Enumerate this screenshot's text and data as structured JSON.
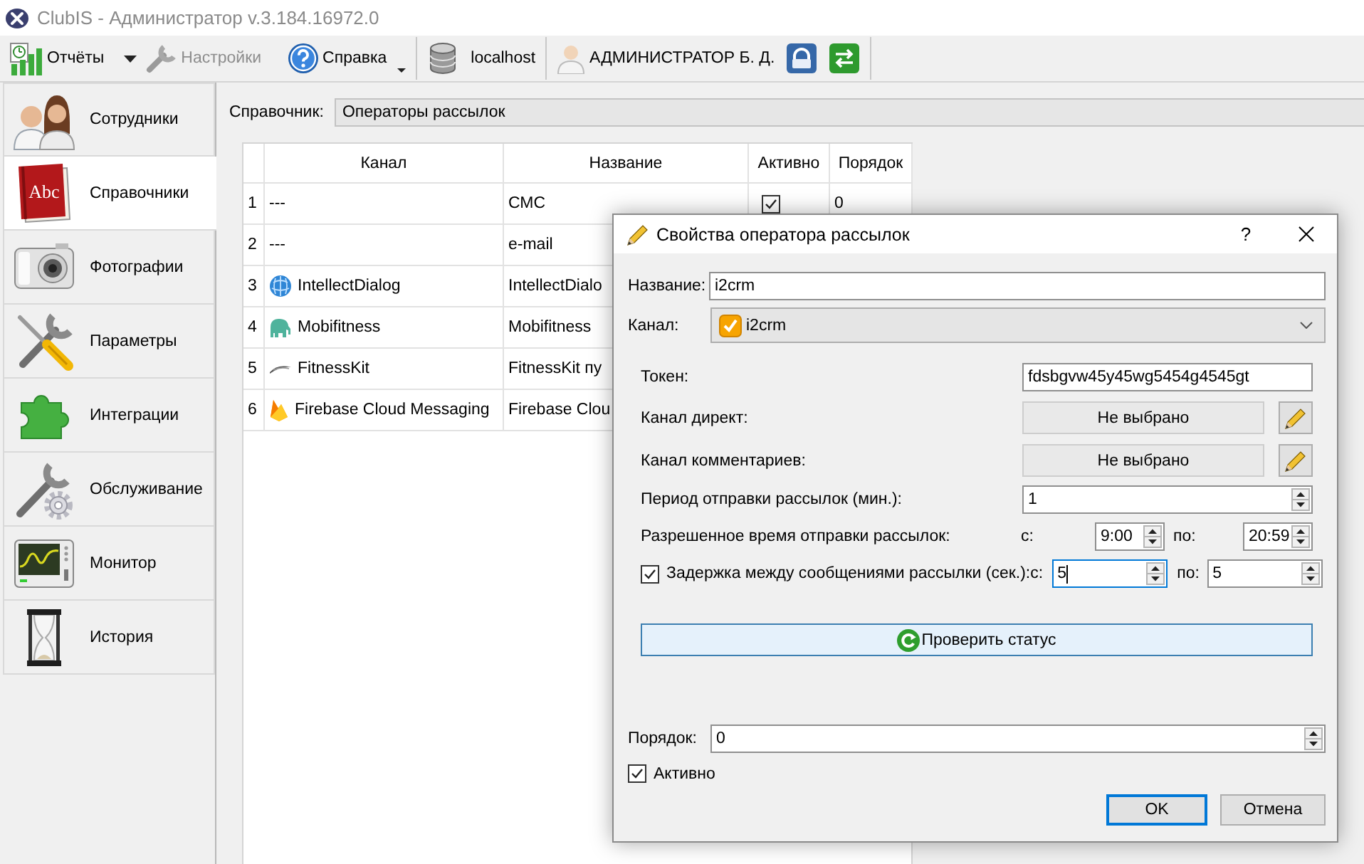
{
  "window": {
    "title": "ClubIS - Администратор v.3.184.16972.0"
  },
  "toolbar": {
    "menus": [
      {
        "label": "Отчёты",
        "disabled": false
      },
      {
        "label": "Настройки",
        "disabled": true
      },
      {
        "label": "Справка",
        "disabled": false
      }
    ],
    "server": "localhost",
    "user": "АДМИНИСТРАТОР Б. Д."
  },
  "sidebar": {
    "items": [
      {
        "label": "Сотрудники",
        "selected": false
      },
      {
        "label": "Справочники",
        "selected": true,
        "icon_text": "Abc"
      },
      {
        "label": "Фотографии",
        "selected": false
      },
      {
        "label": "Параметры",
        "selected": false
      },
      {
        "label": "Интеграции",
        "selected": false
      },
      {
        "label": "Обслуживание",
        "selected": false
      },
      {
        "label": "Монитор",
        "selected": false
      },
      {
        "label": "История",
        "selected": false
      }
    ]
  },
  "directory": {
    "label": "Справочник:",
    "value": "Операторы рассылок"
  },
  "table": {
    "columns": [
      "Канал",
      "Название",
      "Активно",
      "Порядок"
    ],
    "rows": [
      {
        "number": "1",
        "channel": "---",
        "name": "СМС",
        "active": true,
        "order": "0"
      },
      {
        "number": "2",
        "channel": "---",
        "name": "e-mail"
      },
      {
        "number": "3",
        "channel": "IntellectDialog",
        "name": "IntellectDialo"
      },
      {
        "number": "4",
        "channel": "Mobifitness",
        "name": "Mobifitness"
      },
      {
        "number": "5",
        "channel": "FitnessKit",
        "name": "FitnessKit пу"
      },
      {
        "number": "6",
        "channel": "Firebase Cloud Messaging",
        "name": "Firebase Clou"
      }
    ]
  },
  "dialog": {
    "title": "Свойства оператора рассылок",
    "help_button": "?",
    "name": {
      "label": "Название:",
      "value": "i2crm"
    },
    "channel": {
      "label": "Канал:",
      "value": "i2crm"
    },
    "token": {
      "label": "Токен:",
      "value": "fdsbgvw45y45wg5454g4545gt"
    },
    "direct_channel": {
      "label": "Канал директ:",
      "value": "Не выбрано"
    },
    "comment_channel": {
      "label": "Канал комментариев:",
      "value": "Не выбрано"
    },
    "period": {
      "label": "Период отправки рассылок (мин.):",
      "value": "1"
    },
    "allowed_time": {
      "label": "Разрешенное время отправки рассылок:",
      "from_label": "с:",
      "from": {
        "value": "9:00"
      },
      "to_label": "по:",
      "to": {
        "value": "20:59"
      }
    },
    "delay": {
      "label": "Задержка между сообщениями рассылки (сек.):",
      "checked": true,
      "from_label": "с:",
      "from": {
        "value": "5",
        "focused": true
      },
      "to_label": "по:",
      "to": {
        "value": "5",
        "focused": false
      }
    },
    "check_status": {
      "label": "Проверить статус"
    },
    "order": {
      "label": "Порядок:",
      "value": "0"
    },
    "active": {
      "label": "Активно",
      "checked": true
    },
    "buttons": [
      {
        "label": "OK",
        "default": true
      },
      {
        "label": "Отмена",
        "default": false
      }
    ]
  }
}
